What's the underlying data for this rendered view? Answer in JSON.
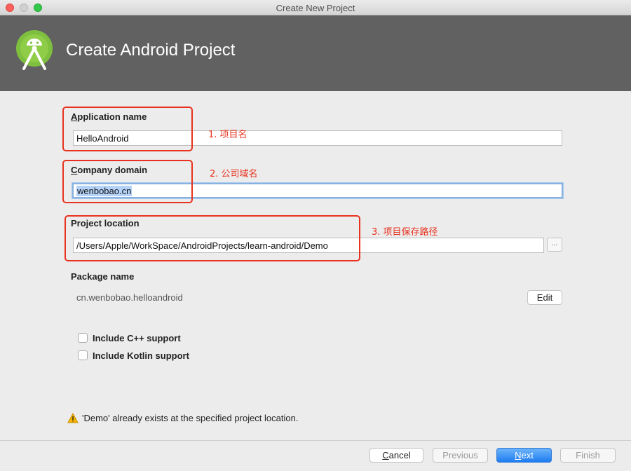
{
  "window": {
    "title": "Create New Project"
  },
  "banner": {
    "title": "Create Android Project"
  },
  "form": {
    "application_name": {
      "label_first": "A",
      "label_rest": "pplication name",
      "value": "HelloAndroid"
    },
    "company_domain": {
      "label_first": "C",
      "label_rest": "ompany domain",
      "value": "wenbobao.cn"
    },
    "project_location": {
      "label": "Project location",
      "value": "/Users/Apple/WorkSpace/AndroidProjects/learn-android/Demo",
      "browse_label": "..."
    },
    "package_name": {
      "label": "Package name",
      "value": "cn.wenbobao.helloandroid",
      "edit_label": "Edit"
    },
    "options": [
      {
        "label": "Include C++ support",
        "checked": false
      },
      {
        "label": "Include Kotlin support",
        "checked": false
      }
    ]
  },
  "annotations": [
    {
      "text": "1. 项目名"
    },
    {
      "text": "2.  公司域名"
    },
    {
      "text": "3. 项目保存路径"
    }
  ],
  "warning": {
    "icon": "warning-icon",
    "text": "'Demo' already exists at the specified project location."
  },
  "footer": {
    "cancel_first": "C",
    "cancel_rest": "ancel",
    "previous_label": "Previous",
    "next_first": "N",
    "next_rest": "ext",
    "finish_label": "Finish"
  },
  "colors": {
    "banner": "#616161",
    "annotation": "#e8321f",
    "primary_button": "#1e7cf1"
  }
}
